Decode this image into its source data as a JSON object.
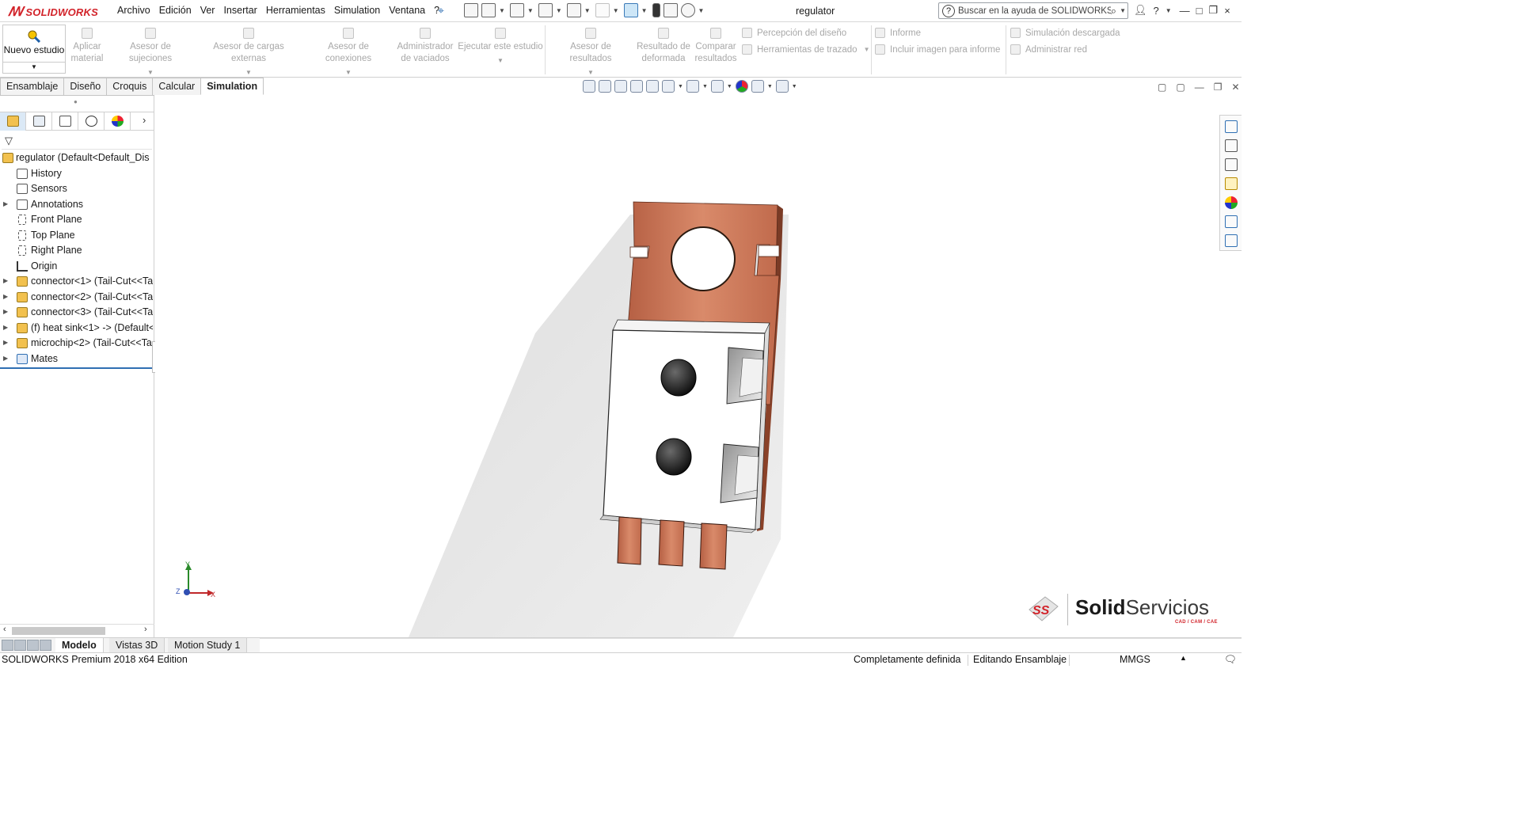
{
  "app": {
    "logo_text": "SOLIDWORKS",
    "document_title": "regulator",
    "menus": [
      "Archivo",
      "Edición",
      "Ver",
      "Insertar",
      "Herramientas",
      "Simulation",
      "Ventana",
      "?"
    ],
    "search_placeholder": "Buscar en la ayuda de SOLIDWORKS",
    "window_controls": [
      "?",
      "—",
      "□",
      "×"
    ]
  },
  "ribbon": {
    "new_study": "Nuevo estudio",
    "apply_material": "Aplicar material",
    "fixtures_advisor": "Asesor de sujeciones",
    "external_loads_advisor": "Asesor de cargas externas",
    "connections_advisor": "Asesor de conexiones",
    "shell_manager": "Administrador de vaciados",
    "run_study": "Ejecutar este estudio",
    "results_advisor": "Asesor de resultados",
    "deformed_result": "Resultado de deformada",
    "compare_results": "Comparar resultados",
    "design_insight": "Percepción del diseño",
    "plot_tools": "Herramientas de trazado",
    "report": "Informe",
    "include_image": "Incluir imagen para informe",
    "offloaded_simulation": "Simulación descargada",
    "manage_network": "Administrar red"
  },
  "command_tabs": [
    {
      "label": "Ensamblaje",
      "active": false
    },
    {
      "label": "Diseño",
      "active": false
    },
    {
      "label": "Croquis",
      "active": false
    },
    {
      "label": "Calcular",
      "active": false
    },
    {
      "label": "Simulation",
      "active": true
    }
  ],
  "tree": {
    "root": "regulator  (Default<Default_Dis",
    "items": [
      {
        "label": "History",
        "expandable": false,
        "icon": "history-icon"
      },
      {
        "label": "Sensors",
        "expandable": false,
        "icon": "sensors-icon"
      },
      {
        "label": "Annotations",
        "expandable": true,
        "icon": "annotations-icon"
      },
      {
        "label": "Front Plane",
        "expandable": false,
        "icon": "plane-icon"
      },
      {
        "label": "Top Plane",
        "expandable": false,
        "icon": "plane-icon"
      },
      {
        "label": "Right Plane",
        "expandable": false,
        "icon": "plane-icon"
      },
      {
        "label": "Origin",
        "expandable": false,
        "icon": "origin-icon"
      },
      {
        "label": "connector<1> (Tail-Cut<<Ta",
        "expandable": true,
        "icon": "part-icon"
      },
      {
        "label": "connector<2> (Tail-Cut<<Ta",
        "expandable": true,
        "icon": "part-icon"
      },
      {
        "label": "connector<3> (Tail-Cut<<Ta",
        "expandable": true,
        "icon": "part-icon"
      },
      {
        "label": "(f) heat sink<1> -> (Default<",
        "expandable": true,
        "icon": "part-icon"
      },
      {
        "label": "microchip<2> (Tail-Cut<<Ta",
        "expandable": true,
        "icon": "part-icon"
      },
      {
        "label": "Mates",
        "expandable": true,
        "icon": "mates-icon"
      }
    ]
  },
  "bottom_tabs": [
    {
      "label": "Modelo",
      "active": true
    },
    {
      "label": "Vistas 3D",
      "active": false
    },
    {
      "label": "Motion Study 1",
      "active": false
    }
  ],
  "status": {
    "edition": "SOLIDWORKS Premium 2018 x64 Edition",
    "definition": "Completamente definida",
    "mode": "Editando Ensamblaje",
    "units": "MMGS"
  },
  "watermark": {
    "brand_bold": "Solid",
    "brand_rest": "Servicios",
    "tagline": "CAD / CAM / CAE"
  },
  "triad": {
    "x": "X",
    "y": "Y",
    "z": "Z"
  },
  "colors": {
    "brand_red": "#d2232a",
    "copper": "#c46a4a",
    "accent_blue": "#2f6fb3"
  }
}
